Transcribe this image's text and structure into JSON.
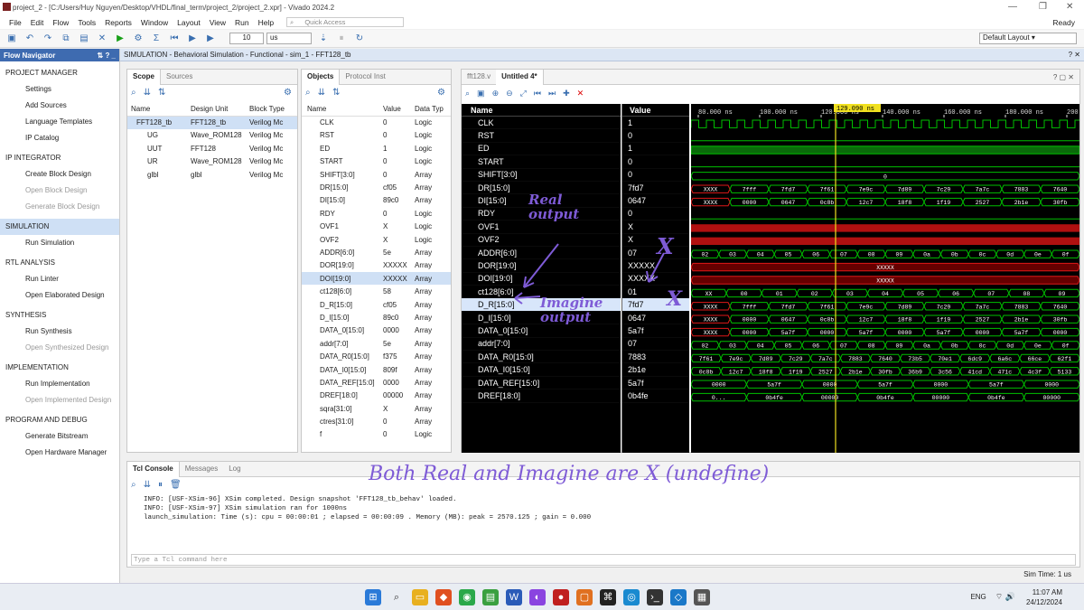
{
  "window": {
    "title": "project_2 - [C:/Users/Huy Nguyen/Desktop/VHDL/final_term/project_2/project_2.xpr] - Vivado 2024.2",
    "status": "Ready"
  },
  "menu": [
    "File",
    "Edit",
    "Flow",
    "Tools",
    "Reports",
    "Window",
    "Layout",
    "View",
    "Run",
    "Help"
  ],
  "quick_access": "Quick Access",
  "toolbar": {
    "time_value": "10",
    "time_unit": "us",
    "layout": "Default Layout"
  },
  "flow_nav": {
    "title": "Flow Navigator",
    "items": [
      {
        "label": "PROJECT MANAGER",
        "kind": "section"
      },
      {
        "label": "Settings",
        "kind": "item"
      },
      {
        "label": "Add Sources",
        "kind": "item"
      },
      {
        "label": "Language Templates",
        "kind": "item"
      },
      {
        "label": "IP Catalog",
        "kind": "item"
      },
      {
        "label": "IP INTEGRATOR",
        "kind": "section"
      },
      {
        "label": "Create Block Design",
        "kind": "item"
      },
      {
        "label": "Open Block Design",
        "kind": "disabled"
      },
      {
        "label": "Generate Block Design",
        "kind": "disabled"
      },
      {
        "label": "SIMULATION",
        "kind": "section-selected"
      },
      {
        "label": "Run Simulation",
        "kind": "item"
      },
      {
        "label": "RTL ANALYSIS",
        "kind": "section"
      },
      {
        "label": "Run Linter",
        "kind": "item"
      },
      {
        "label": "Open Elaborated Design",
        "kind": "item"
      },
      {
        "label": "SYNTHESIS",
        "kind": "section"
      },
      {
        "label": "Run Synthesis",
        "kind": "item"
      },
      {
        "label": "Open Synthesized Design",
        "kind": "disabled"
      },
      {
        "label": "IMPLEMENTATION",
        "kind": "section"
      },
      {
        "label": "Run Implementation",
        "kind": "item"
      },
      {
        "label": "Open Implemented Design",
        "kind": "disabled"
      },
      {
        "label": "PROGRAM AND DEBUG",
        "kind": "section"
      },
      {
        "label": "Generate Bitstream",
        "kind": "item"
      },
      {
        "label": "Open Hardware Manager",
        "kind": "item"
      }
    ]
  },
  "sim_title": "SIMULATION - Behavioral Simulation - Functional - sim_1 - FFT128_tb",
  "scope": {
    "tabs": [
      "Scope",
      "Sources"
    ],
    "headers": [
      "Name",
      "Design Unit",
      "Block Type"
    ],
    "rows": [
      [
        "FFT128_tb",
        "FFT128_tb",
        "Verilog Mc"
      ],
      [
        "UG",
        "Wave_ROM128",
        "Verilog Mc"
      ],
      [
        "UUT",
        "FFT128",
        "Verilog Mc"
      ],
      [
        "UR",
        "Wave_ROM128",
        "Verilog Mc"
      ],
      [
        "glbl",
        "glbl",
        "Verilog Mc"
      ]
    ]
  },
  "objects": {
    "tabs": [
      "Objects",
      "Protocol Inst"
    ],
    "headers": [
      "Name",
      "Value",
      "Data Typ"
    ],
    "rows": [
      [
        "CLK",
        "0",
        "Logic"
      ],
      [
        "RST",
        "0",
        "Logic"
      ],
      [
        "ED",
        "1",
        "Logic"
      ],
      [
        "START",
        "0",
        "Logic"
      ],
      [
        "SHIFT[3:0]",
        "0",
        "Array"
      ],
      [
        "DR[15:0]",
        "cf05",
        "Array"
      ],
      [
        "DI[15:0]",
        "89c0",
        "Array"
      ],
      [
        "RDY",
        "0",
        "Logic"
      ],
      [
        "OVF1",
        "X",
        "Logic"
      ],
      [
        "OVF2",
        "X",
        "Logic"
      ],
      [
        "ADDR[6:0]",
        "5e",
        "Array"
      ],
      [
        "DOR[19:0]",
        "XXXXX",
        "Array"
      ],
      [
        "DOI[19:0]",
        "XXXXX",
        "Array"
      ],
      [
        "ct128[6:0]",
        "58",
        "Array"
      ],
      [
        "D_R[15:0]",
        "cf05",
        "Array"
      ],
      [
        "D_I[15:0]",
        "89c0",
        "Array"
      ],
      [
        "DATA_0[15:0]",
        "0000",
        "Array"
      ],
      [
        "addr[7:0]",
        "5e",
        "Array"
      ],
      [
        "DATA_R0[15:0]",
        "f375",
        "Array"
      ],
      [
        "DATA_I0[15:0]",
        "809f",
        "Array"
      ],
      [
        "DATA_REF[15:0]",
        "0000",
        "Array"
      ],
      [
        "DREF[18:0]",
        "00000",
        "Array"
      ],
      [
        "sqra[31:0]",
        "X",
        "Array"
      ],
      [
        "ctres[31:0]",
        "0",
        "Array"
      ],
      [
        "f",
        "0",
        "Logic"
      ]
    ]
  },
  "wave": {
    "tabs": [
      "fft128.v",
      "Untitled 4*"
    ],
    "cursor": "129.090 ns",
    "time_labels": [
      "80.000 ns",
      "100.000 ns",
      "120.000 ns",
      "140.000 ns",
      "160.000 ns",
      "180.000 ns",
      "200.000"
    ],
    "headers": [
      "Name",
      "Value"
    ],
    "rows": [
      {
        "name": "CLK",
        "value": "1",
        "kind": "clk"
      },
      {
        "name": "RST",
        "value": "0",
        "kind": "low"
      },
      {
        "name": "ED",
        "value": "1",
        "kind": "high"
      },
      {
        "name": "START",
        "value": "0",
        "kind": "low"
      },
      {
        "name": "SHIFT[3:0]",
        "value": "0",
        "kind": "bus",
        "segs": [
          "0"
        ]
      },
      {
        "name": "DR[15:0]",
        "value": "7fd7",
        "kind": "busred",
        "segs": [
          "XXXX",
          "7fff",
          "7fd7",
          "7f61",
          "7e9c",
          "7d89",
          "7c29",
          "7a7c",
          "7883",
          "7640"
        ]
      },
      {
        "name": "DI[15:0]",
        "value": "0647",
        "kind": "busred",
        "segs": [
          "XXXX",
          "0000",
          "0647",
          "0c8b",
          "12c7",
          "18f8",
          "1f19",
          "2527",
          "2b1e",
          "30fb"
        ]
      },
      {
        "name": "RDY",
        "value": "0",
        "kind": "low"
      },
      {
        "name": "OVF1",
        "value": "X",
        "kind": "x"
      },
      {
        "name": "OVF2",
        "value": "X",
        "kind": "x"
      },
      {
        "name": "ADDR[6:0]",
        "value": "07",
        "kind": "bus",
        "segs": [
          "02",
          "03",
          "04",
          "05",
          "06",
          "07",
          "08",
          "09",
          "0a",
          "0b",
          "0c",
          "0d",
          "0e",
          "0f"
        ]
      },
      {
        "name": "DOR[19:0]",
        "value": "XXXXX",
        "kind": "xbus",
        "segs": [
          "XXXXX"
        ]
      },
      {
        "name": "DOI[19:0]",
        "value": "XXXXX",
        "kind": "xbus",
        "segs": [
          "XXXXX"
        ]
      },
      {
        "name": "ct128[6:0]",
        "value": "01",
        "kind": "bus",
        "segs": [
          "XX",
          "00",
          "01",
          "02",
          "03",
          "04",
          "05",
          "06",
          "07",
          "08",
          "09"
        ]
      },
      {
        "name": "D_R[15:0]",
        "value": "7fd7",
        "kind": "busred",
        "segs": [
          "XXXX",
          "7fff",
          "7fd7",
          "7f61",
          "7e9c",
          "7d89",
          "7c29",
          "7a7c",
          "7883",
          "7640"
        ]
      },
      {
        "name": "D_I[15:0]",
        "value": "0647",
        "kind": "busred",
        "segs": [
          "XXXX",
          "0000",
          "0647",
          "0c8b",
          "12c7",
          "18f8",
          "1f19",
          "2527",
          "2b1e",
          "30fb"
        ]
      },
      {
        "name": "DATA_0[15:0]",
        "value": "5a7f",
        "kind": "busred",
        "segs": [
          "XXXX",
          "0000",
          "5a7f",
          "0000",
          "5a7f",
          "0000",
          "5a7f",
          "0000",
          "5a7f",
          "0000"
        ]
      },
      {
        "name": "addr[7:0]",
        "value": "07",
        "kind": "bus",
        "segs": [
          "02",
          "03",
          "04",
          "05",
          "06",
          "07",
          "08",
          "09",
          "0a",
          "0b",
          "0c",
          "0d",
          "0e",
          "0f"
        ]
      },
      {
        "name": "DATA_R0[15:0]",
        "value": "7883",
        "kind": "bus",
        "segs": [
          "7f61",
          "7e9c",
          "7d89",
          "7c29",
          "7a7c",
          "7883",
          "7640",
          "73b5",
          "70e1",
          "6dc9",
          "6a6c",
          "66ce",
          "62f1"
        ]
      },
      {
        "name": "DATA_I0[15:0]",
        "value": "2b1e",
        "kind": "bus",
        "segs": [
          "0c8b",
          "12c7",
          "18f8",
          "1f19",
          "2527",
          "2b1e",
          "30fb",
          "36b9",
          "3c56",
          "41cd",
          "471c",
          "4c3f",
          "5133"
        ]
      },
      {
        "name": "DATA_REF[15:0]",
        "value": "5a7f",
        "kind": "bus",
        "segs": [
          "0000",
          "5a7f",
          "0000",
          "5a7f",
          "0000",
          "5a7f",
          "0000"
        ]
      },
      {
        "name": "DREF[18:0]",
        "value": "0b4fe",
        "kind": "bus",
        "segs": [
          "0...",
          "0b4fe",
          "00000",
          "0b4fe",
          "00000",
          "0b4fe",
          "00000"
        ]
      }
    ]
  },
  "console": {
    "tabs": [
      "Tcl Console",
      "Messages",
      "Log"
    ],
    "lines": [
      "INFO: [USF-XSim-96] XSim completed. Design snapshot 'FFT128_tb_behav' loaded.",
      "INFO: [USF-XSim-97] XSim simulation ran for 1000ns",
      "launch_simulation: Time (s): cpu = 00:00:01 ; elapsed = 00:00:09 . Memory (MB): peak = 2570.125 ; gain = 0.000"
    ],
    "placeholder": "Type a Tcl command here"
  },
  "sim_time": "Sim Time: 1 us",
  "taskbar": {
    "lang": "ENG",
    "time": "11:07 AM",
    "date": "24/12/2024"
  },
  "annotations": {
    "real": "Real output",
    "imag": "Imagine output",
    "x": "X",
    "bottom": "Both Real and Imagine are X (undefine)"
  },
  "colors": {
    "accent": "#3e6bb0",
    "wave_green": "#00c000",
    "wave_red": "#e01818",
    "cursor": "#f0e020"
  }
}
